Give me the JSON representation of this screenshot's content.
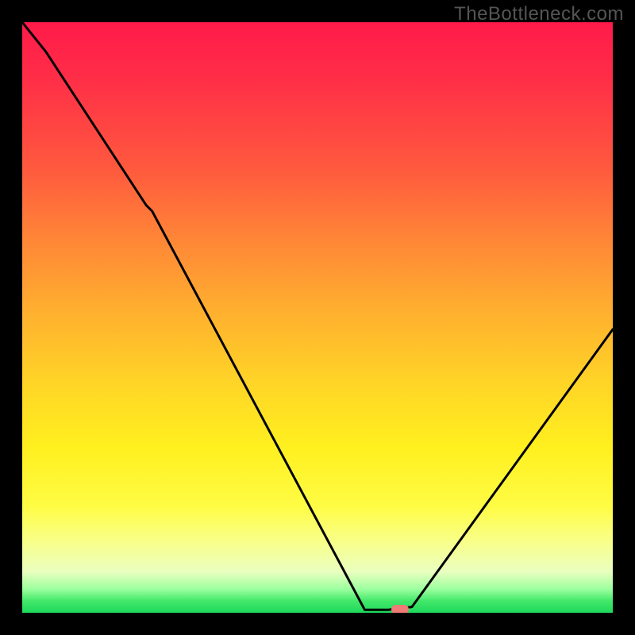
{
  "watermark": "TheBottleneck.com",
  "colors": {
    "frame": "#000000",
    "curve": "#000000",
    "marker": "#ef7a76"
  },
  "chart_data": {
    "type": "line",
    "title": "",
    "xlabel": "",
    "ylabel": "",
    "xlim": [
      0,
      100
    ],
    "ylim": [
      0,
      100
    ],
    "grid": false,
    "series": [
      {
        "name": "bottleneck-curve",
        "x": [
          0,
          4,
          21,
          22,
          58,
          62,
          66,
          100
        ],
        "values": [
          100,
          95,
          69,
          68,
          0.5,
          0.5,
          1,
          48
        ]
      }
    ],
    "annotations": [
      {
        "name": "optimal-marker",
        "x": 64,
        "y": 0.5
      }
    ],
    "background_gradient_stops": [
      {
        "pos": 0.0,
        "color": "#ff1a4a"
      },
      {
        "pos": 0.25,
        "color": "#ff5a3e"
      },
      {
        "pos": 0.5,
        "color": "#ffb32e"
      },
      {
        "pos": 0.72,
        "color": "#fff01f"
      },
      {
        "pos": 0.93,
        "color": "#eaffc0"
      },
      {
        "pos": 1.0,
        "color": "#1ed85b"
      }
    ]
  }
}
